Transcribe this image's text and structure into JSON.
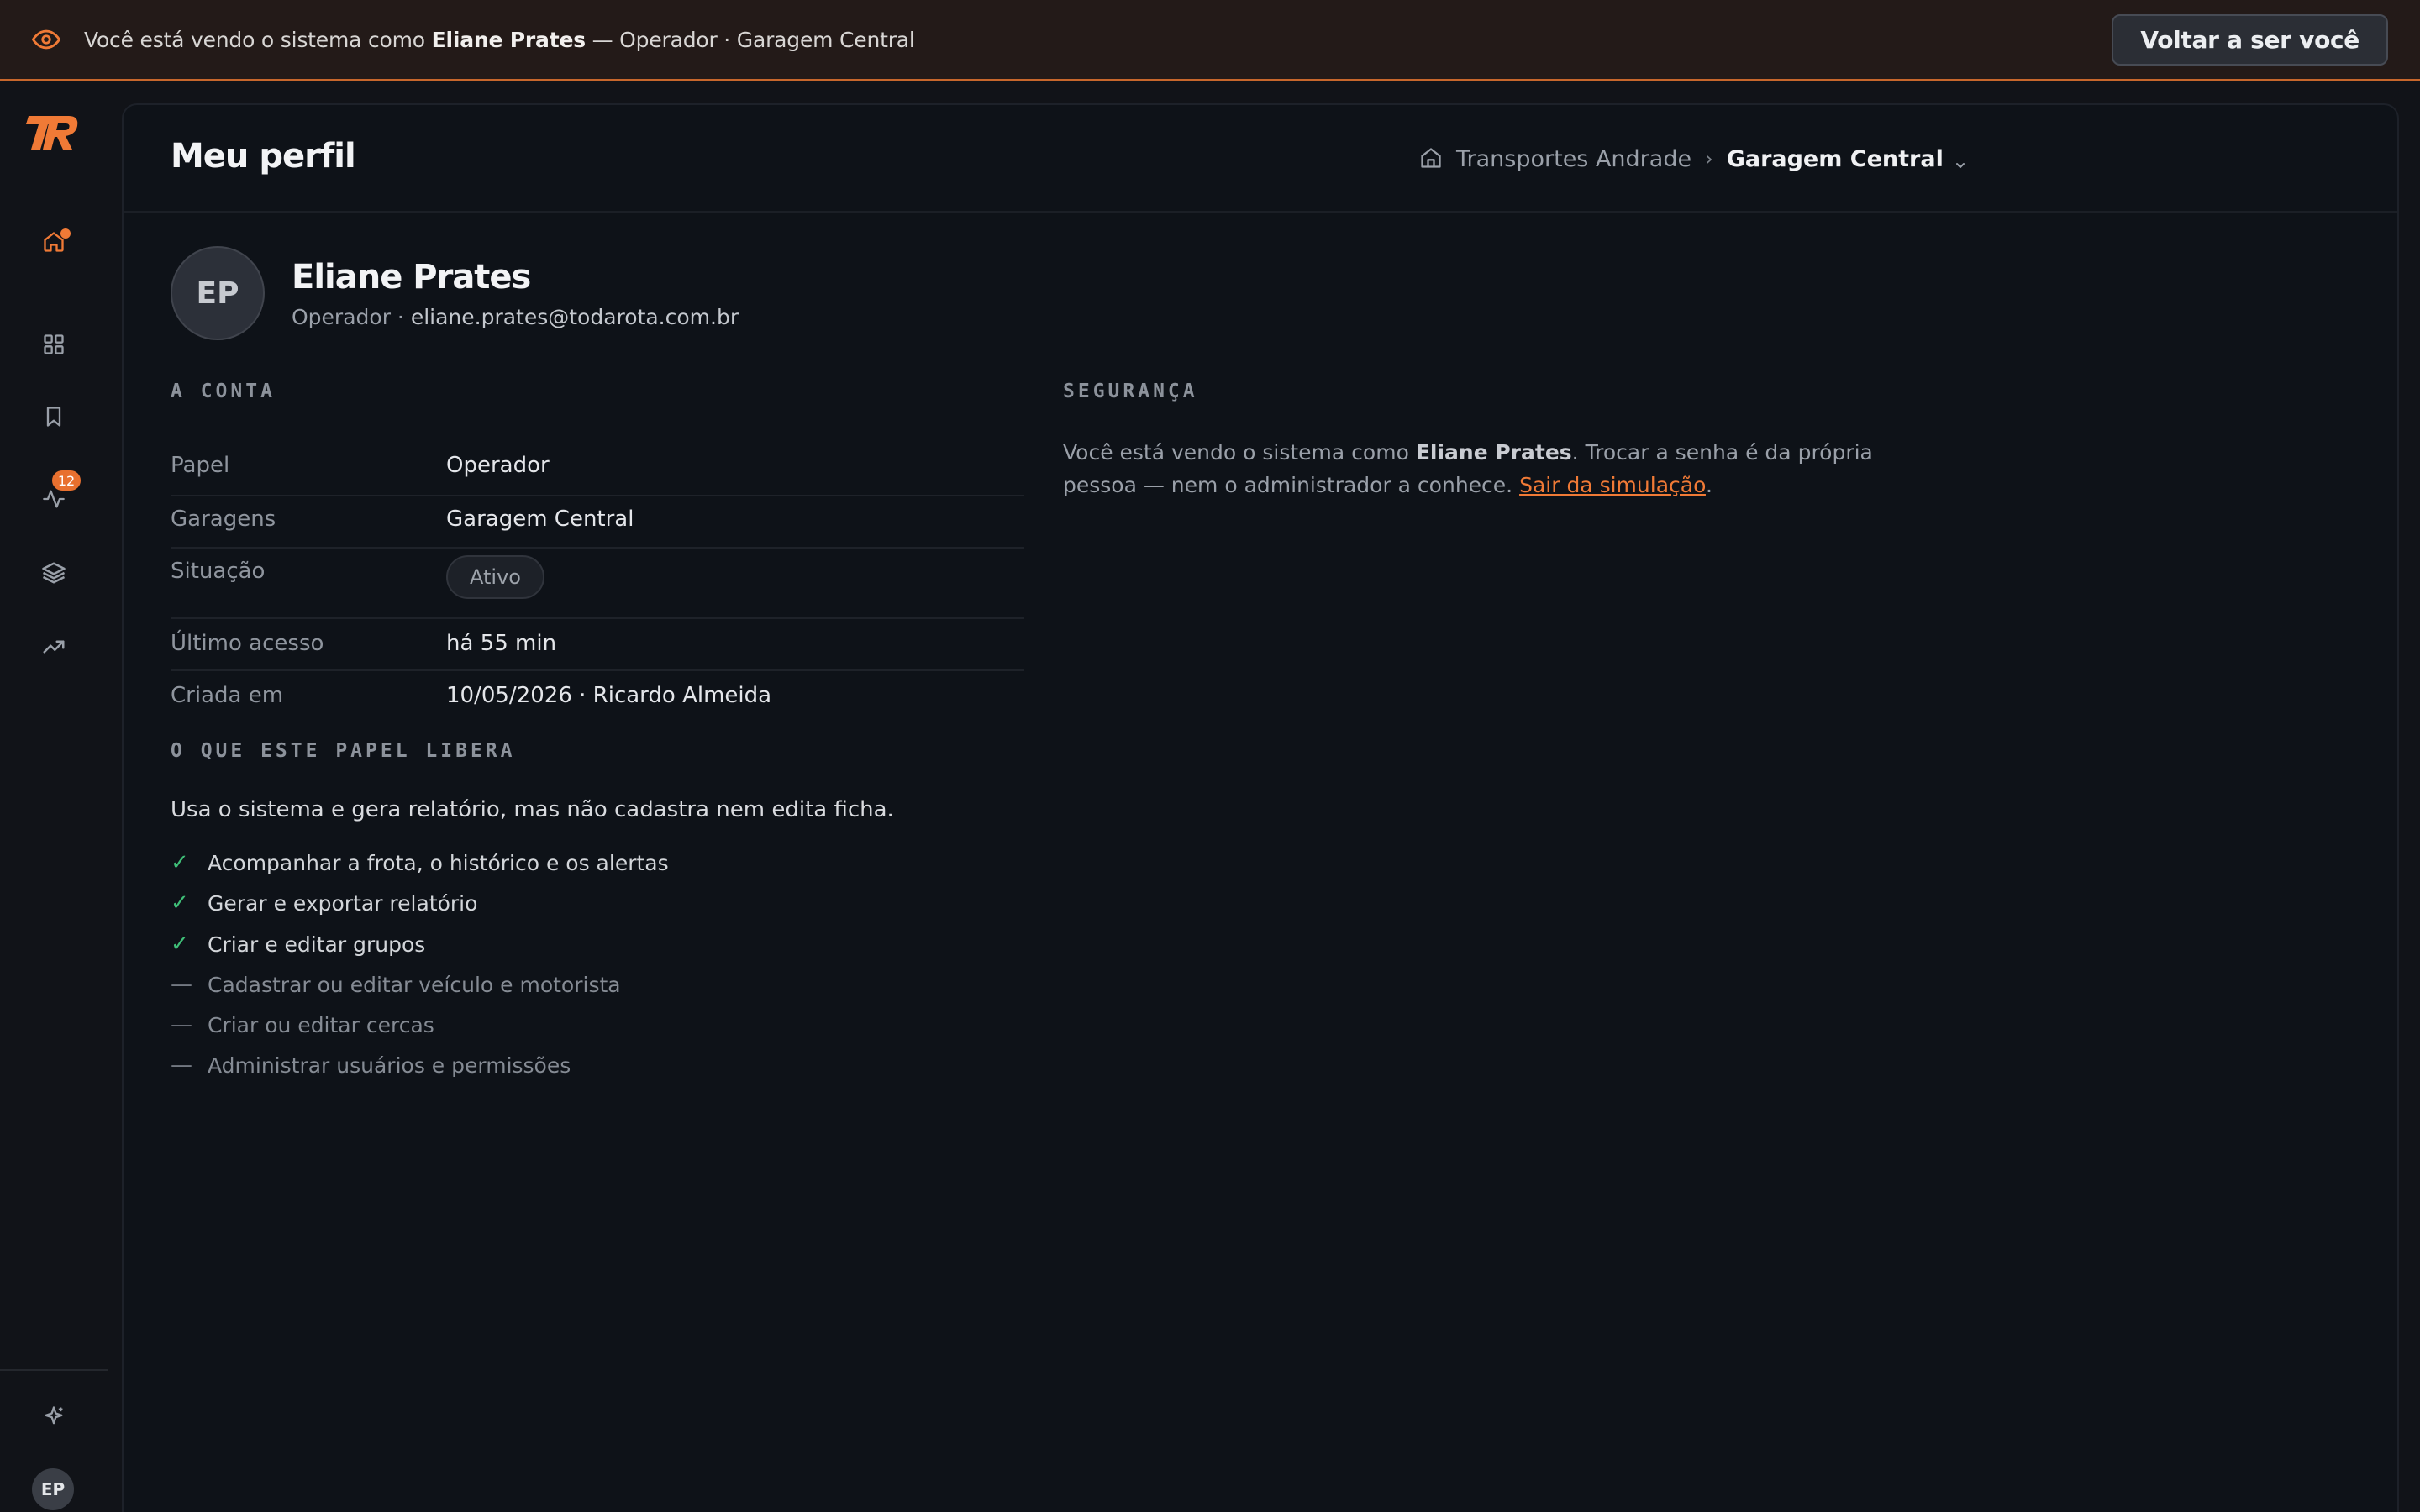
{
  "banner": {
    "prefix": "Você está vendo o sistema como ",
    "user": "Eliane Prates",
    "suffix": " — Operador · Garagem Central",
    "back_button": "Voltar a ser você"
  },
  "sidebar": {
    "alerts_badge": "12",
    "avatar_initials": "EP"
  },
  "header": {
    "title": "Meu perfil",
    "breadcrumb_org": "Transportes Andrade",
    "breadcrumb_sep": "›",
    "breadcrumb_garage": "Garagem Central"
  },
  "profile": {
    "initials": "EP",
    "name": "Eliane Prates",
    "role": "Operador · ",
    "email": "eliane.prates@todarota.com.br"
  },
  "account": {
    "title": "A CONTA",
    "rows": [
      {
        "label": "Papel",
        "value": "Operador"
      },
      {
        "label": "Garagens",
        "value": "Garagem Central"
      },
      {
        "label": "Situação",
        "value": "Ativo"
      },
      {
        "label": "Último acesso",
        "value": "há 55 min"
      },
      {
        "label": "Criada em",
        "value": "10/05/2026 · Ricardo Almeida"
      }
    ]
  },
  "security": {
    "title": "SEGURANÇA",
    "text_1": "Você está vendo o sistema como ",
    "user": "Eliane Prates",
    "text_2": ". Trocar a senha é da própria pessoa — nem o administrador a conhece. ",
    "link": "Sair da simulação",
    "text_3": "."
  },
  "role_permissions": {
    "title": "O QUE ESTE PAPEL LIBERA",
    "description": "Usa o sistema e gera relatório, mas não cadastra nem edita ficha.",
    "allowed_mark": "✓",
    "denied_mark": "—",
    "items": [
      {
        "text": "Acompanhar a frota, o histórico e os alertas",
        "allowed": true
      },
      {
        "text": "Gerar e exportar relatório",
        "allowed": true
      },
      {
        "text": "Criar e editar grupos",
        "allowed": true
      },
      {
        "text": "Cadastrar ou editar veículo e motorista",
        "allowed": false
      },
      {
        "text": "Criar ou editar cercas",
        "allowed": false
      },
      {
        "text": "Administrar usuários e permissões",
        "allowed": false
      }
    ]
  },
  "colors": {
    "accent": "#f07a36",
    "allowed": "#3fbf78",
    "banner_bg": "#231a18",
    "page_bg": "#111318"
  }
}
